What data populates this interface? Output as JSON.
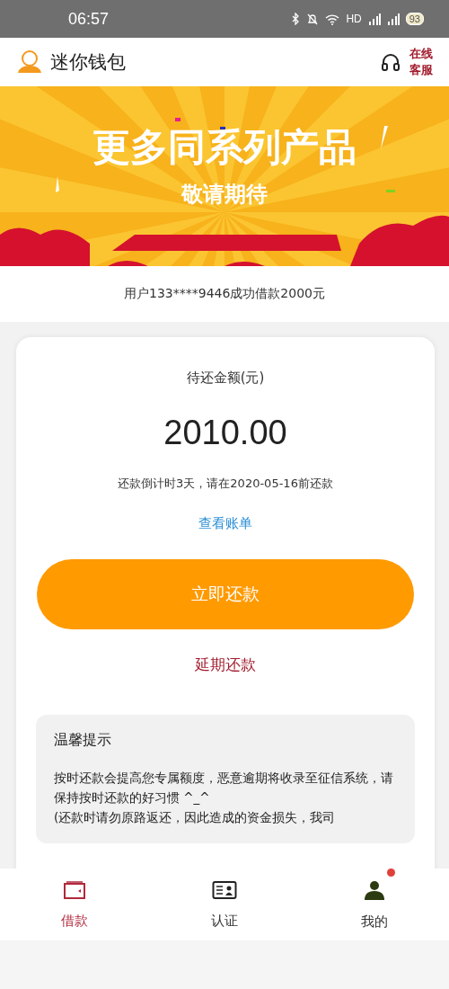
{
  "status_bar": {
    "time": "06:57",
    "network": "HD",
    "battery": "93"
  },
  "header": {
    "title": "迷你钱包",
    "service_lines": [
      "在线",
      "客服"
    ]
  },
  "banner": {
    "title": "更多同系列产品",
    "subtitle": "敬请期待"
  },
  "notice": "用户133****9446成功借款2000元",
  "repayment": {
    "label": "待还金额(元)",
    "amount": "2010.00",
    "countdown": "还款倒计时3天，请在2020-05-16前还款",
    "bill_link": "查看账单",
    "primary_button": "立即还款",
    "secondary_button": "延期还款"
  },
  "tips": {
    "title": "温馨提示",
    "lines": [
      "按时还款会提高您专属额度，恶意逾期将收录至征信系统，请保持按时还款的好习惯 ^_^",
      "(还款时请勿原路返还，因此造成的资金损失，我司"
    ]
  },
  "tab_bar": [
    {
      "label": "借款",
      "kind": "wallet",
      "selected": true,
      "dot": false
    },
    {
      "label": "认证",
      "kind": "idcard",
      "selected": false,
      "dot": false
    },
    {
      "label": "我的",
      "kind": "person",
      "selected": false,
      "dot": true
    }
  ]
}
